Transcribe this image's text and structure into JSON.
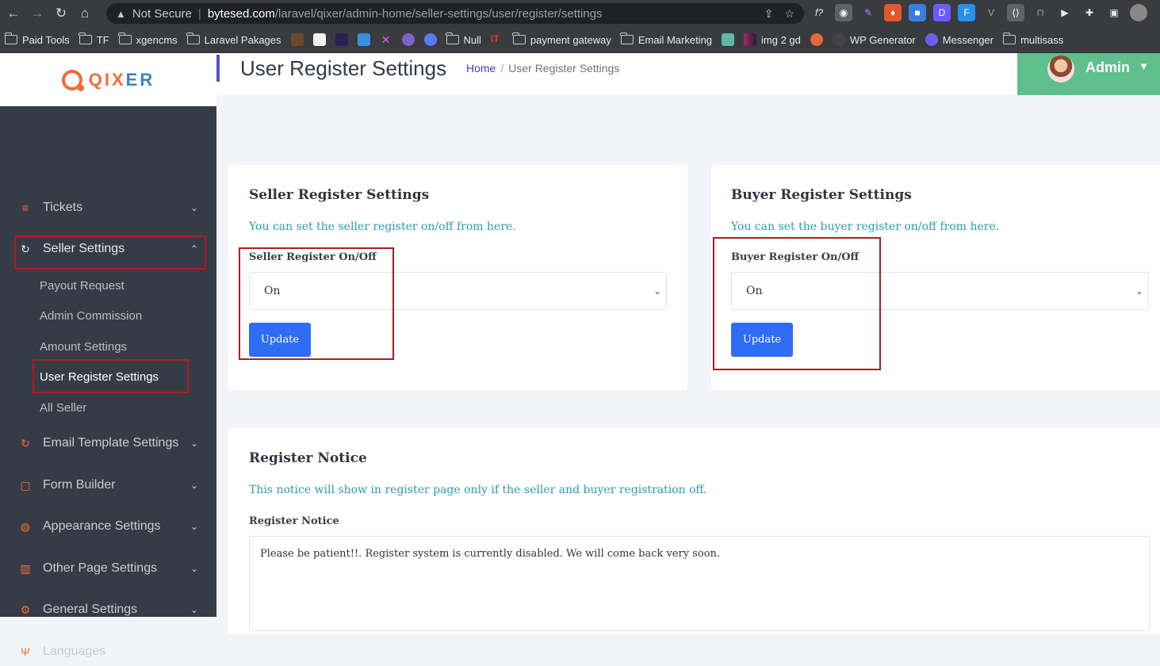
{
  "browser": {
    "security_label": "Not Secure",
    "url_host": "bytesed.com",
    "url_path": "/laravel/qixer/admin-home/seller-settings/user/register/settings",
    "bookmarks": [
      "Paid Tools",
      "TF",
      "xgencms",
      "Laravel Pakages",
      "Null",
      "payment gateway",
      "Email Marketing",
      "img 2 gd",
      "WP Generator",
      "Messenger",
      "multisass"
    ]
  },
  "brand": {
    "name_a": "QIX",
    "name_b": "ER"
  },
  "sidebar": {
    "items": [
      {
        "label": "Tickets",
        "icon": "list-icon"
      },
      {
        "label": "Seller Settings",
        "icon": "refresh-icon"
      },
      {
        "label": "Email Template Settings",
        "icon": "refresh-icon"
      },
      {
        "label": "Form Builder",
        "icon": "form-icon"
      },
      {
        "label": "Appearance Settings",
        "icon": "palette-icon"
      },
      {
        "label": "Other Page Settings",
        "icon": "chart-icon"
      },
      {
        "label": "General Settings",
        "icon": "gear-icon"
      },
      {
        "label": "Languages",
        "icon": "antenna-icon"
      }
    ],
    "sub_items": [
      "Payout Request",
      "Admin Commission",
      "Amount Settings",
      "User Register Settings",
      "All Seller"
    ]
  },
  "header": {
    "title": "User Register Settings",
    "breadcrumb_home": "Home",
    "breadcrumb_sep": "/",
    "breadcrumb_current": "User Register Settings",
    "user_name": "Admin"
  },
  "seller_card": {
    "title": "Seller Register Settings",
    "description": "You can set the seller register on/off from here.",
    "field_label": "Seller Register On/Off",
    "selected": "On",
    "button": "Update"
  },
  "buyer_card": {
    "title": "Buyer Register Settings",
    "description": "You can set the buyer register on/off from here.",
    "field_label": "Buyer Register On/Off",
    "selected": "On",
    "button": "Update"
  },
  "notice_card": {
    "title": "Register Notice",
    "description": "This notice will show in register page only if the seller and buyer registration off.",
    "field_label": "Register Notice",
    "value": "Please be patient!!. Register system is currently disabled. We will come back very soon."
  },
  "colors": {
    "sidebar_bg": "#363c46",
    "accent": "#f26b38",
    "admin_bg": "#5fbf8c",
    "button": "#2e6cf6",
    "desc": "#2b9bb0",
    "highlight": "#b01c1c"
  }
}
